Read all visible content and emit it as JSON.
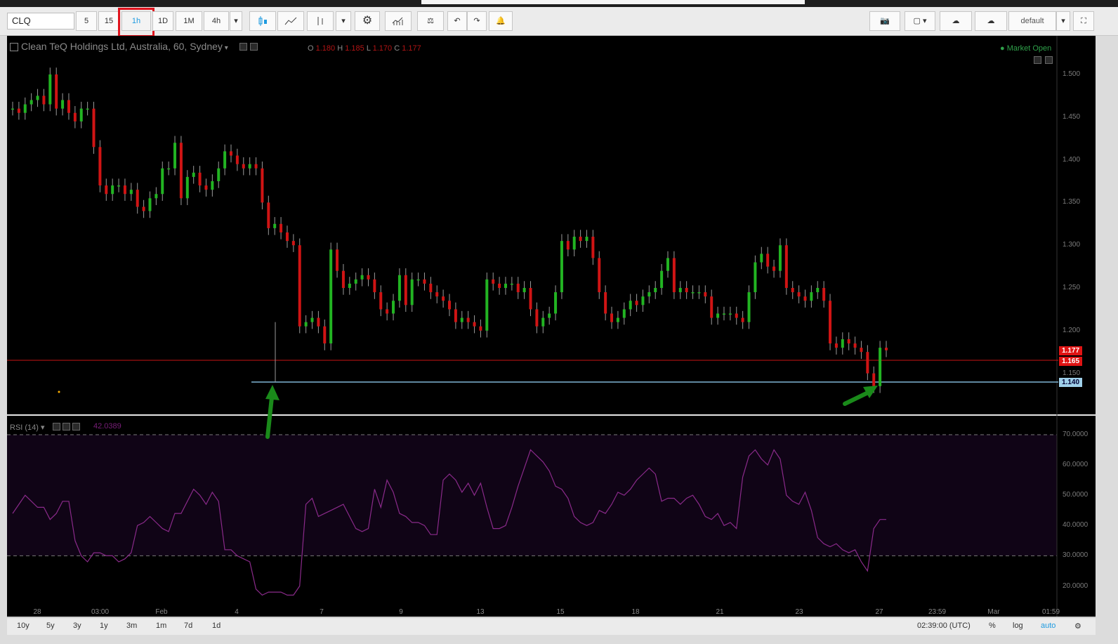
{
  "toolbar": {
    "symbol": "CLQ",
    "intervals": [
      "5",
      "15",
      "1h",
      "1D",
      "1M",
      "4h"
    ],
    "selected_interval": "1h",
    "layout_name": "default"
  },
  "legend": {
    "title": "Clean TeQ Holdings Ltd, Australia, 60, Sydney",
    "o_label": "O",
    "o": "1.180",
    "h_label": "H",
    "h": "1.185",
    "l_label": "L",
    "l": "1.170",
    "c_label": "C",
    "c": "1.177",
    "status": "Market Open"
  },
  "price_axis": [
    "1.500",
    "1.450",
    "1.400",
    "1.350",
    "1.300",
    "1.250",
    "1.200",
    "1.150"
  ],
  "price_tags": {
    "last": "1.177",
    "red_line": "1.165",
    "blue_line": "1.140"
  },
  "rsi": {
    "label": "RSI (14)",
    "value": "42.0389",
    "axis": [
      "70.0000",
      "60.0000",
      "50.0000",
      "40.0000",
      "30.0000",
      "20.0000"
    ]
  },
  "time_axis": [
    "28",
    "03:00",
    "Feb",
    "4",
    "7",
    "9",
    "13",
    "15",
    "18",
    "21",
    "23",
    "27",
    "23:59",
    "Mar",
    "01:59"
  ],
  "bottom": {
    "ranges": [
      "10y",
      "5y",
      "3y",
      "1y",
      "3m",
      "1m",
      "7d",
      "1d"
    ],
    "clock": "02:39:00 (UTC)",
    "pct": "%",
    "log": "log",
    "auto": "auto"
  },
  "colors": {
    "up": "#22b422",
    "down": "#d01414",
    "rsi": "#8a2a8a",
    "hline_red": "#c81414",
    "hline_blue": "#7fb6d6",
    "arrow": "#1a8a1a"
  },
  "candles_close": [
    1.46,
    1.455,
    1.465,
    1.47,
    1.475,
    1.465,
    1.5,
    1.46,
    1.47,
    1.455,
    1.445,
    1.46,
    1.46,
    1.415,
    1.37,
    1.36,
    1.37,
    1.37,
    1.36,
    1.365,
    1.345,
    1.34,
    1.355,
    1.36,
    1.39,
    1.39,
    1.42,
    1.355,
    1.38,
    1.385,
    1.37,
    1.365,
    1.375,
    1.39,
    1.41,
    1.405,
    1.395,
    1.39,
    1.395,
    1.39,
    1.35,
    1.32,
    1.325,
    1.315,
    1.305,
    1.3,
    1.205,
    1.21,
    1.215,
    1.205,
    1.185,
    1.295,
    1.27,
    1.25,
    1.255,
    1.26,
    1.265,
    1.26,
    1.245,
    1.225,
    1.22,
    1.235,
    1.265,
    1.23,
    1.26,
    1.26,
    1.255,
    1.245,
    1.24,
    1.235,
    1.225,
    1.21,
    1.215,
    1.21,
    1.205,
    1.2,
    1.26,
    1.255,
    1.25,
    1.255,
    1.255,
    1.245,
    1.25,
    1.225,
    1.205,
    1.215,
    1.22,
    1.245,
    1.305,
    1.295,
    1.31,
    1.305,
    1.31,
    1.285,
    1.245,
    1.22,
    1.21,
    1.215,
    1.225,
    1.235,
    1.23,
    1.24,
    1.245,
    1.25,
    1.27,
    1.285,
    1.245,
    1.25,
    1.245,
    1.245,
    1.245,
    1.24,
    1.215,
    1.22,
    1.22,
    1.22,
    1.215,
    1.21,
    1.245,
    1.28,
    1.29,
    1.275,
    1.27,
    1.3,
    1.25,
    1.245,
    1.24,
    1.235,
    1.245,
    1.25,
    1.235,
    1.185,
    1.18,
    1.19,
    1.185,
    1.18,
    1.175,
    1.15,
    1.135,
    1.18,
    1.177
  ],
  "rsi_values": [
    44,
    47,
    50,
    48,
    46,
    46,
    42,
    44,
    48,
    48,
    35,
    30,
    28,
    31,
    31,
    30,
    30,
    28,
    29,
    31,
    40,
    41,
    43,
    41,
    39,
    38,
    44,
    44,
    48,
    52,
    50,
    47,
    51,
    48,
    32,
    32,
    30,
    29,
    28,
    19,
    17,
    18,
    18,
    18,
    17,
    17,
    20,
    47,
    49,
    43,
    44,
    45,
    46,
    47,
    43,
    39,
    38,
    39,
    52,
    46,
    55,
    51,
    44,
    43,
    41,
    41,
    40,
    37,
    37,
    55,
    57,
    55,
    51,
    54,
    50,
    54,
    46,
    39,
    39,
    40,
    46,
    53,
    59,
    65,
    63,
    61,
    58,
    53,
    52,
    49,
    43,
    41,
    40,
    41,
    45,
    44,
    47,
    51,
    50,
    52,
    55,
    57,
    59,
    57,
    48,
    49,
    49,
    47,
    49,
    50,
    47,
    43,
    42,
    44,
    40,
    41,
    39,
    56,
    63,
    65,
    62,
    60,
    65,
    62,
    50,
    48,
    47,
    51,
    45,
    36,
    34,
    33,
    34,
    32,
    31,
    32,
    28,
    25,
    39,
    42,
    42
  ]
}
